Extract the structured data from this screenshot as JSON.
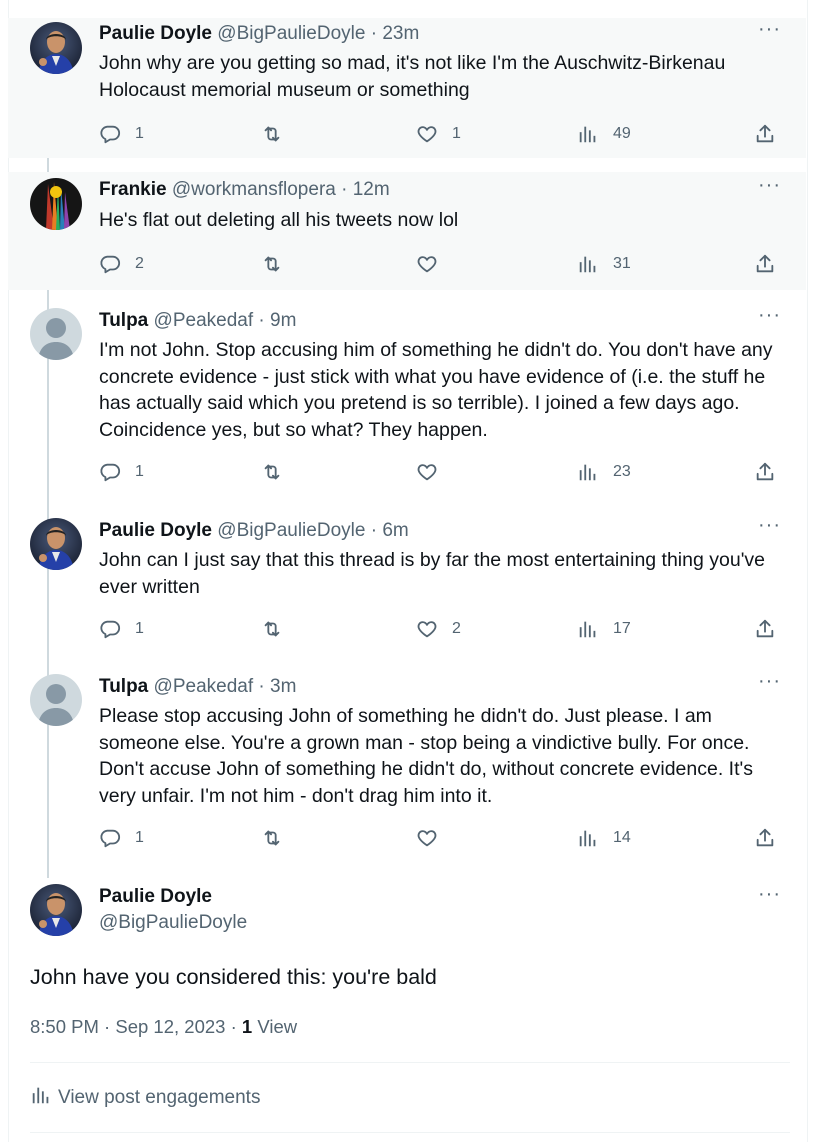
{
  "tweets": [
    {
      "name": "Paulie Doyle",
      "handle": "@BigPaulieDoyle",
      "time": "23m",
      "text": "John why are you getting so mad, it's not like I'm the Auschwitz-Birkenau Holocaust memorial museum or something",
      "replies": "1",
      "reposts": "",
      "likes": "1",
      "views": "49",
      "avatar": "paulie"
    },
    {
      "name": "Frankie",
      "handle": "@workmansflopera",
      "time": "12m",
      "text": "He's flat out deleting all his tweets now lol",
      "replies": "2",
      "reposts": "",
      "likes": "",
      "views": "31",
      "avatar": "frankie"
    },
    {
      "name": "Tulpa",
      "handle": "@Peakedaf",
      "time": "9m",
      "text": "I'm not John. Stop accusing him of something he didn't do. You don't have any concrete evidence - just stick with what you have evidence of (i.e. the stuff he has actually said which you pretend is so terrible). I joined a few days ago. Coincidence yes, but so what? They happen.",
      "replies": "1",
      "reposts": "",
      "likes": "",
      "views": "23",
      "avatar": "default"
    },
    {
      "name": "Paulie Doyle",
      "handle": "@BigPaulieDoyle",
      "time": "6m",
      "text": "John can I just say that this thread is by far the most entertaining thing you've ever written",
      "replies": "1",
      "reposts": "",
      "likes": "2",
      "views": "17",
      "avatar": "paulie"
    },
    {
      "name": "Tulpa",
      "handle": "@Peakedaf",
      "time": "3m",
      "text": "Please stop accusing John of something he didn't do. Just please. I am someone else. You're a grown man - stop being a vindictive bully. For once. Don't accuse John of something he didn't do, without concrete evidence. It's very unfair. I'm not him - don't drag him into it.",
      "replies": "1",
      "reposts": "",
      "likes": "",
      "views": "14",
      "avatar": "default"
    }
  ],
  "main_tweet": {
    "name": "Paulie Doyle",
    "handle": "@BigPaulieDoyle",
    "text": "John have you considered this: you're bald",
    "time": "8:50 PM",
    "date": "Sep 12, 2023",
    "view_count": "1",
    "view_label": "View",
    "engagements_label": "View post engagements"
  },
  "separator": "·",
  "more_glyph": "···",
  "icons": [
    "reply-icon",
    "repost-icon",
    "like-icon",
    "views-icon",
    "share-icon",
    "more-icon",
    "analytics-icon"
  ],
  "colors": {
    "text": "#0f1419",
    "secondary": "#536471",
    "thread_line": "#cfd9de",
    "shaded_bg": "#f7f9f9"
  }
}
